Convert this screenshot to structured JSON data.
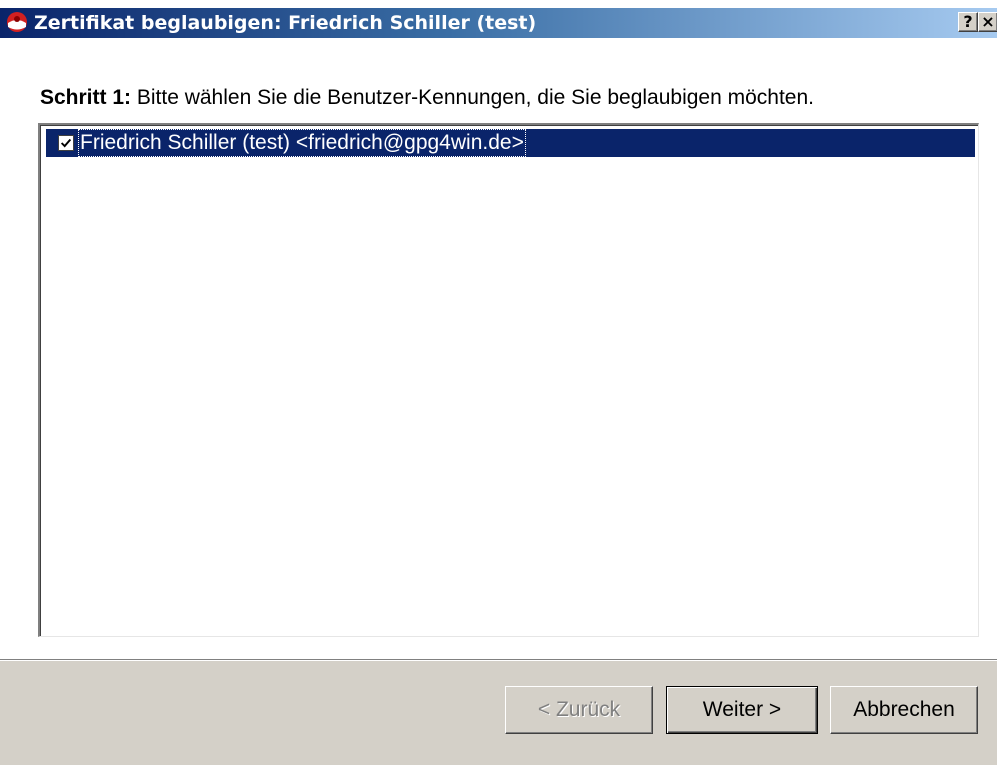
{
  "window": {
    "title": "Zertifikat beglaubigen: Friedrich Schiller (test)",
    "help_label": "?",
    "close_label": "×",
    "icon": "gpg4win-kleopatra-icon",
    "colors": {
      "titlebar_start": "#0a246a",
      "titlebar_end": "#a6caf0",
      "selection": "#0a246a",
      "face": "#d4d0c8"
    }
  },
  "step": {
    "prefix": "Schritt 1:",
    "text": " Bitte wählen Sie die Benutzer-Kennungen, die Sie beglaubigen möchten."
  },
  "user_ids": [
    {
      "label": "Friedrich Schiller (test) <friedrich@gpg4win.de>",
      "checked": true,
      "selected": true
    }
  ],
  "buttons": {
    "back": "< Zurück",
    "next": "Weiter >",
    "cancel": "Abbrechen"
  }
}
